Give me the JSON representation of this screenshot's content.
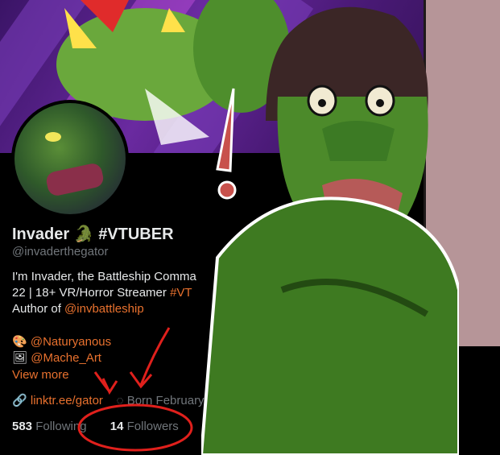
{
  "profile": {
    "name": "Invader",
    "tag": "#VTUBER",
    "emoji": "🐊",
    "handle": "@invaderthegator",
    "bio_line1": "I'm Invader, the Battleship Comma",
    "bio_line2a": "22 | 18+ VR/Horror Streamer ",
    "bio_line2b": "#VT",
    "bio_line3a": "Author of ",
    "bio_line3b": "@invbattleship",
    "credit1_icon": "🎨",
    "credit1": "@Naturyanous",
    "credit2_icon": "🖼",
    "credit2": "@Mache_Art",
    "view_more": "View more",
    "link": "linktr.ee/gator",
    "born": "Born February",
    "following_count": "583",
    "following_label": "Following",
    "followers_count": "14",
    "followers_label": "Followers"
  },
  "colors": {
    "accent": "#e8712e",
    "annotation": "#e0201c",
    "muted": "#71767b"
  },
  "icons": {
    "link": "link-icon",
    "birthday": "balloon-icon"
  }
}
